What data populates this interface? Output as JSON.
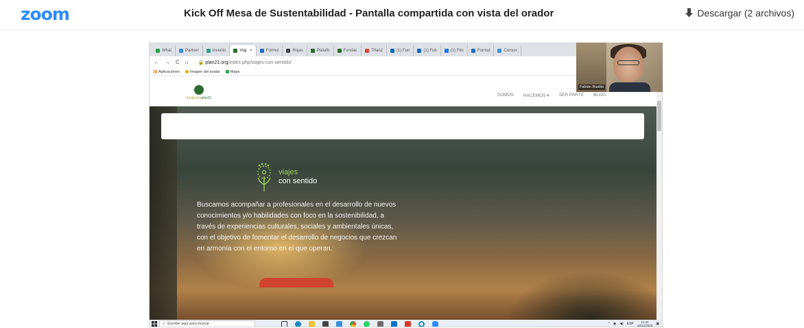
{
  "app": {
    "logo": "zoom",
    "title": "Kick Off Mesa de Sustentabilidad - Pantalla compartida con vista del orador",
    "download_label": "Descargar (2 archivos)"
  },
  "browser": {
    "tabs": [
      {
        "label": "What",
        "active": false,
        "color": "#2aa24a"
      },
      {
        "label": "Partner",
        "active": false,
        "color": "#3a8fd8"
      },
      {
        "label": "Invento",
        "active": false,
        "color": "#2b9e8f"
      },
      {
        "label": "Viaj",
        "active": true,
        "color": "#2e6b2e"
      },
      {
        "label": "Formul",
        "active": false,
        "color": "#1f6fbf"
      },
      {
        "label": "Rojas",
        "active": false,
        "color": "#444444"
      },
      {
        "label": "Platafo",
        "active": false,
        "color": "#2e6b2e"
      },
      {
        "label": "Fundac",
        "active": false,
        "color": "#2e6b2e"
      },
      {
        "label": "\"Plan2",
        "active": false,
        "color": "#d44638"
      },
      {
        "label": "(1) Fun",
        "active": false,
        "color": "#0a66c2"
      },
      {
        "label": "(1) Fub",
        "active": false,
        "color": "#0a66c2"
      },
      {
        "label": "(1) Fito",
        "active": false,
        "color": "#1877f2"
      },
      {
        "label": "Formul",
        "active": false,
        "color": "#1f6fbf"
      },
      {
        "label": "Comun",
        "active": false,
        "color": "#3a8fd8"
      }
    ],
    "url_domain": "plan21.org",
    "url_path": "/index.php/viajes-con-sentido/",
    "bookmarks": [
      "Aplicaciones",
      "Imagen del avatar",
      "Maps"
    ]
  },
  "site": {
    "brand_part1": "fundación",
    "brand_part2": "plan21",
    "menu": [
      "SOMOS",
      "HACEMOS ▾",
      "SER PARTE",
      "BLOG"
    ],
    "logo_line1": "viajes",
    "logo_line2": "con sentido",
    "description": "Buscamos acompañar a profesionales en el desarrollo de nuevos conocimientos y/o habilidades con foco en la sostenibilidad, a través de experiencias culturales, sociales y ambientales únicas, con el objetivo de fomentar el desarrollo de negocios que crezcan en armonía con el entorno en el que operan."
  },
  "taskbar": {
    "search_placeholder": "Escribe aquí para buscar",
    "language": "ESP",
    "time": "11:34",
    "date": "18/12/2020"
  },
  "speaker": {
    "name": "Fabián Ruslán"
  },
  "colors": {
    "zoom_blue": "#2d8cff",
    "site_green": "#2e6b2e",
    "cta_red": "#d0432e"
  }
}
